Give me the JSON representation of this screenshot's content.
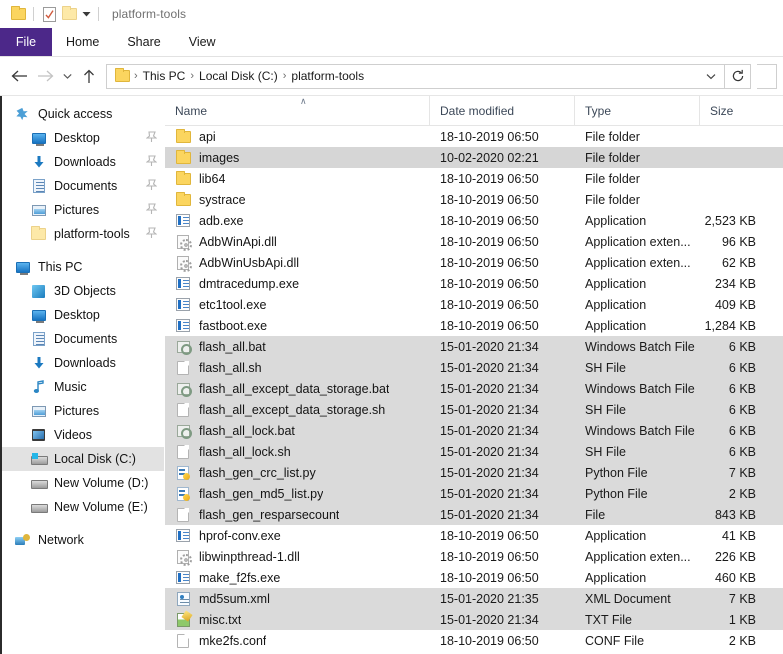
{
  "window": {
    "title": "platform-tools",
    "quick_access_icons": [
      "folder-icon",
      "properties-icon",
      "new-folder-icon",
      "customize-caret-icon"
    ]
  },
  "ribbon": {
    "tabs": [
      {
        "label": "File",
        "active": true
      },
      {
        "label": "Home",
        "active": false
      },
      {
        "label": "Share",
        "active": false
      },
      {
        "label": "View",
        "active": false
      }
    ],
    "file_tab_color": "#4c2889"
  },
  "address": {
    "back_icon": "back-arrow-icon",
    "forward_icon": "forward-arrow-icon",
    "history_icon": "recent-locations-caret-icon",
    "up_icon": "up-arrow-icon",
    "breadcrumbs": [
      "This PC",
      "Local Disk (C:)",
      "platform-tools"
    ],
    "separator": "›",
    "dropdown_icon": "chevron-down-icon",
    "refresh_icon": "refresh-icon"
  },
  "sidebar": {
    "groups": [
      {
        "header": {
          "label": "Quick access",
          "icon": "star-pin-icon"
        },
        "items": [
          {
            "label": "Desktop",
            "icon": "monitor-icon",
            "pinned": true
          },
          {
            "label": "Downloads",
            "icon": "download-arrow-icon",
            "pinned": true
          },
          {
            "label": "Documents",
            "icon": "document-icon",
            "pinned": true
          },
          {
            "label": "Pictures",
            "icon": "picture-icon",
            "pinned": true
          },
          {
            "label": "platform-tools",
            "icon": "folder-icon",
            "pinned": true
          }
        ]
      },
      {
        "header": {
          "label": "This PC",
          "icon": "monitor-icon"
        },
        "items": [
          {
            "label": "3D Objects",
            "icon": "cube-icon",
            "pinned": false
          },
          {
            "label": "Desktop",
            "icon": "monitor-icon",
            "pinned": false
          },
          {
            "label": "Documents",
            "icon": "document-icon",
            "pinned": false
          },
          {
            "label": "Downloads",
            "icon": "download-arrow-icon",
            "pinned": false
          },
          {
            "label": "Music",
            "icon": "music-note-icon",
            "pinned": false
          },
          {
            "label": "Pictures",
            "icon": "picture-icon",
            "pinned": false
          },
          {
            "label": "Videos",
            "icon": "video-icon",
            "pinned": false
          },
          {
            "label": "Local Disk (C:)",
            "icon": "system-drive-icon",
            "pinned": false,
            "selected": true
          },
          {
            "label": "New Volume (D:)",
            "icon": "drive-icon",
            "pinned": false
          },
          {
            "label": "New Volume (E:)",
            "icon": "drive-icon",
            "pinned": false
          }
        ]
      },
      {
        "header": {
          "label": "Network",
          "icon": "network-icon"
        },
        "items": []
      }
    ],
    "pin_glyph": "📌"
  },
  "columns": {
    "name": "Name",
    "date_modified": "Date modified",
    "type": "Type",
    "size": "Size",
    "sort_indicator": "∧",
    "sorted_by": "Name",
    "sort_direction": "ascending"
  },
  "files": [
    {
      "name": "api",
      "date": "18-10-2019 06:50",
      "type": "File folder",
      "size": "",
      "icon": "folder-icon",
      "state": ""
    },
    {
      "name": "images",
      "date": "10-02-2020 02:21",
      "type": "File folder",
      "size": "",
      "icon": "folder-icon",
      "state": "hover"
    },
    {
      "name": "lib64",
      "date": "18-10-2019 06:50",
      "type": "File folder",
      "size": "",
      "icon": "folder-icon",
      "state": ""
    },
    {
      "name": "systrace",
      "date": "18-10-2019 06:50",
      "type": "File folder",
      "size": "",
      "icon": "folder-icon",
      "state": ""
    },
    {
      "name": "adb.exe",
      "date": "18-10-2019 06:50",
      "type": "Application",
      "size": "2,523 KB",
      "icon": "exe-icon",
      "state": ""
    },
    {
      "name": "AdbWinApi.dll",
      "date": "18-10-2019 06:50",
      "type": "Application exten...",
      "size": "96 KB",
      "icon": "dll-icon",
      "state": ""
    },
    {
      "name": "AdbWinUsbApi.dll",
      "date": "18-10-2019 06:50",
      "type": "Application exten...",
      "size": "62 KB",
      "icon": "dll-icon",
      "state": ""
    },
    {
      "name": "dmtracedump.exe",
      "date": "18-10-2019 06:50",
      "type": "Application",
      "size": "234 KB",
      "icon": "exe-icon",
      "state": ""
    },
    {
      "name": "etc1tool.exe",
      "date": "18-10-2019 06:50",
      "type": "Application",
      "size": "409 KB",
      "icon": "exe-icon",
      "state": ""
    },
    {
      "name": "fastboot.exe",
      "date": "18-10-2019 06:50",
      "type": "Application",
      "size": "1,284 KB",
      "icon": "exe-icon",
      "state": ""
    },
    {
      "name": "flash_all.bat",
      "date": "15-01-2020 21:34",
      "type": "Windows Batch File",
      "size": "6 KB",
      "icon": "bat-icon",
      "state": "sel"
    },
    {
      "name": "flash_all.sh",
      "date": "15-01-2020 21:34",
      "type": "SH File",
      "size": "6 KB",
      "icon": "page-icon",
      "state": "sel"
    },
    {
      "name": "flash_all_except_data_storage.bat",
      "date": "15-01-2020 21:34",
      "type": "Windows Batch File",
      "size": "6 KB",
      "icon": "bat-icon",
      "state": "sel"
    },
    {
      "name": "flash_all_except_data_storage.sh",
      "date": "15-01-2020 21:34",
      "type": "SH File",
      "size": "6 KB",
      "icon": "page-icon",
      "state": "sel"
    },
    {
      "name": "flash_all_lock.bat",
      "date": "15-01-2020 21:34",
      "type": "Windows Batch File",
      "size": "6 KB",
      "icon": "bat-icon",
      "state": "sel"
    },
    {
      "name": "flash_all_lock.sh",
      "date": "15-01-2020 21:34",
      "type": "SH File",
      "size": "6 KB",
      "icon": "page-icon",
      "state": "sel"
    },
    {
      "name": "flash_gen_crc_list.py",
      "date": "15-01-2020 21:34",
      "type": "Python File",
      "size": "7 KB",
      "icon": "py-icon",
      "state": "sel"
    },
    {
      "name": "flash_gen_md5_list.py",
      "date": "15-01-2020 21:34",
      "type": "Python File",
      "size": "2 KB",
      "icon": "py-icon",
      "state": "sel"
    },
    {
      "name": "flash_gen_resparsecount",
      "date": "15-01-2020 21:34",
      "type": "File",
      "size": "843 KB",
      "icon": "page-icon",
      "state": "sel"
    },
    {
      "name": "hprof-conv.exe",
      "date": "18-10-2019 06:50",
      "type": "Application",
      "size": "41 KB",
      "icon": "exe-icon",
      "state": ""
    },
    {
      "name": "libwinpthread-1.dll",
      "date": "18-10-2019 06:50",
      "type": "Application exten...",
      "size": "226 KB",
      "icon": "dll-icon",
      "state": ""
    },
    {
      "name": "make_f2fs.exe",
      "date": "18-10-2019 06:50",
      "type": "Application",
      "size": "460 KB",
      "icon": "exe-icon",
      "state": ""
    },
    {
      "name": "md5sum.xml",
      "date": "15-01-2020 21:35",
      "type": "XML Document",
      "size": "7 KB",
      "icon": "xml-icon",
      "state": "sel"
    },
    {
      "name": "misc.txt",
      "date": "15-01-2020 21:34",
      "type": "TXT File",
      "size": "1 KB",
      "icon": "txt-icon",
      "state": "sel"
    },
    {
      "name": "mke2fs.conf",
      "date": "18-10-2019 06:50",
      "type": "CONF File",
      "size": "2 KB",
      "icon": "page-icon",
      "state": ""
    }
  ]
}
